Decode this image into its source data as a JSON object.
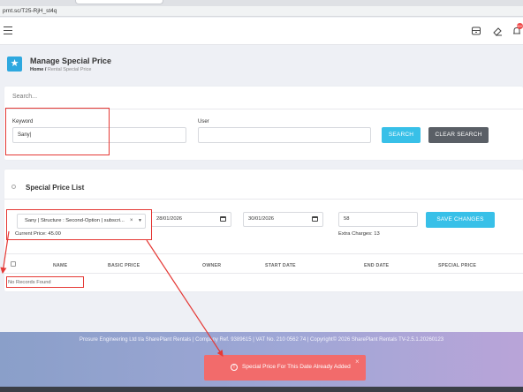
{
  "browser": {
    "url": "prnt.sc/T25-RjH_st4q"
  },
  "header": {
    "notification_badge": "99+",
    "icons": [
      "store-icon",
      "eraser-icon",
      "bell-icon"
    ]
  },
  "page": {
    "title": "Manage Special Price",
    "breadcrumb_home": "Home",
    "breadcrumb_sep": "/",
    "breadcrumb_current": "Rental Special Price"
  },
  "search": {
    "title": "Search...",
    "keyword_label": "Keyword",
    "keyword_value": "Sany|",
    "user_label": "User",
    "user_value": "",
    "search_button": "SEARCH",
    "clear_button": "CLEAR SEARCH"
  },
  "special_price": {
    "title": "Special Price List",
    "selected_item": "Sany | Structure : Second-Option | subscri...",
    "clear_symbol": "×",
    "current_price": "Current Price: 45.00",
    "start_date": "28/01/2026",
    "end_date": "30/01/2026",
    "charge_value": "58",
    "extra_charges": "Extra Charges: 13",
    "save_button": "SAVE CHANGES",
    "columns": [
      "NAME",
      "BASIC PRICE",
      "OWNER",
      "START DATE",
      "END DATE",
      "SPECIAL PRICE"
    ],
    "empty_message": "No Records Found"
  },
  "footer": {
    "text": "Prosure Engineering Ltd t/a SharePlant Rentals | Company Ref. 9389615 | VAT No. 210 0562 74 | Copyright© 2026 SharePlant Rentals TV-2.5.1.20260123"
  },
  "toast": {
    "icon": "!",
    "message": "Special Price For This Date Already Added",
    "close": "×"
  },
  "colors": {
    "accent": "#38c0e8",
    "clear_button": "#5a5f66",
    "toast": "#f26b6b",
    "annotation": "#e53935"
  }
}
